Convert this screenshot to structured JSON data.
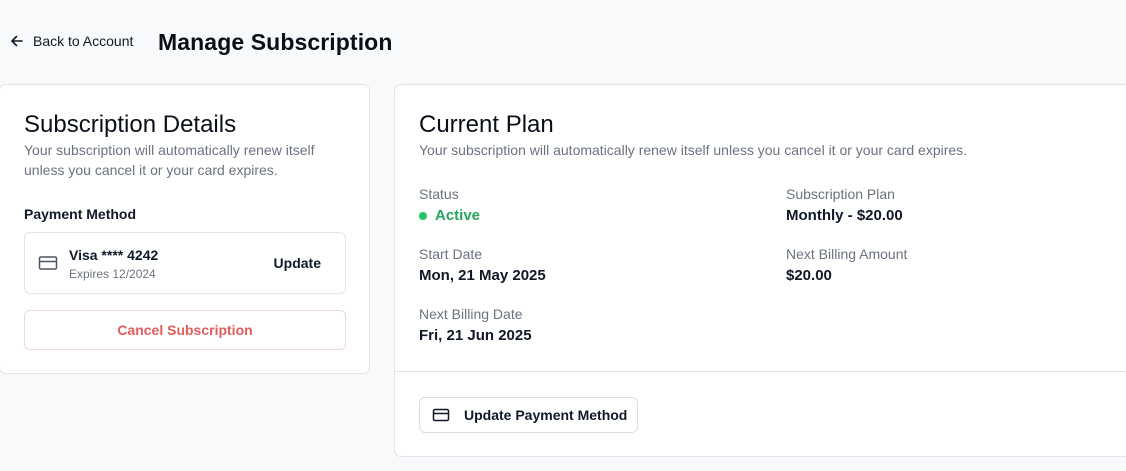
{
  "header": {
    "back_label": "Back to Account",
    "title": "Manage Subscription"
  },
  "subscription_details": {
    "title": "Subscription Details",
    "description": "Your subscription will automatically renew itself unless you cancel it or your card expires.",
    "payment_method_label": "Payment Method",
    "card_name": "Visa **** 4242",
    "card_expiry": "Expires 12/2024",
    "update_label": "Update",
    "cancel_label": "Cancel Subscription"
  },
  "current_plan": {
    "title": "Current Plan",
    "description": "Your subscription will automatically renew itself unless you cancel it or your card expires.",
    "status_label": "Status",
    "status_value": "Active",
    "plan_label": "Subscription Plan",
    "plan_value": "Monthly - $20.00",
    "start_date_label": "Start Date",
    "start_date_value": "Mon, 21 May 2025",
    "next_amount_label": "Next Billing Amount",
    "next_amount_value": "$20.00",
    "next_date_label": "Next Billing Date",
    "next_date_value": "Fri, 21 Jun 2025",
    "update_payment_label": "Update Payment Method"
  },
  "icons": {
    "back": "arrow-left-icon",
    "card": "credit-card-icon"
  },
  "colors": {
    "active": "#22a55a",
    "danger": "#e25c5c"
  }
}
